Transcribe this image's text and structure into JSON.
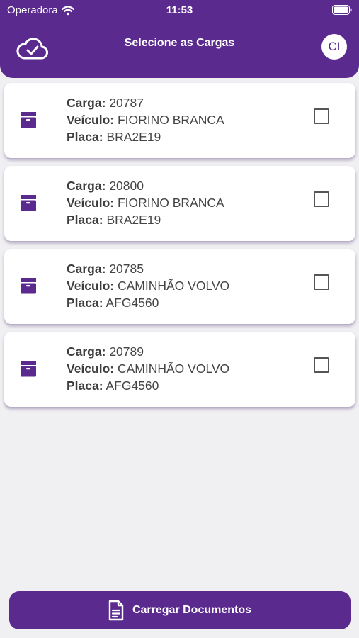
{
  "status_bar": {
    "carrier": "Operadora",
    "time": "11:53"
  },
  "header": {
    "title": "Selecione as Cargas",
    "avatar_initials": "CI",
    "sync_icon": "cloud-check-icon"
  },
  "labels": {
    "carga": "Carga:",
    "veiculo": "Veículo:",
    "placa": "Placa:"
  },
  "loads": [
    {
      "carga": "20787",
      "veiculo": "FIORINO BRANCA",
      "placa": "BRA2E19",
      "checked": false
    },
    {
      "carga": "20800",
      "veiculo": "FIORINO BRANCA",
      "placa": "BRA2E19",
      "checked": false
    },
    {
      "carga": "20785",
      "veiculo": "CAMINHÃO VOLVO",
      "placa": "AFG4560",
      "checked": false
    },
    {
      "carga": "20789",
      "veiculo": "CAMINHÃO VOLVO",
      "placa": "AFG4560",
      "checked": false
    }
  ],
  "footer": {
    "button_label": "Carregar Documentos"
  },
  "colors": {
    "primary": "#5b2a8e",
    "background": "#f0eff2"
  }
}
